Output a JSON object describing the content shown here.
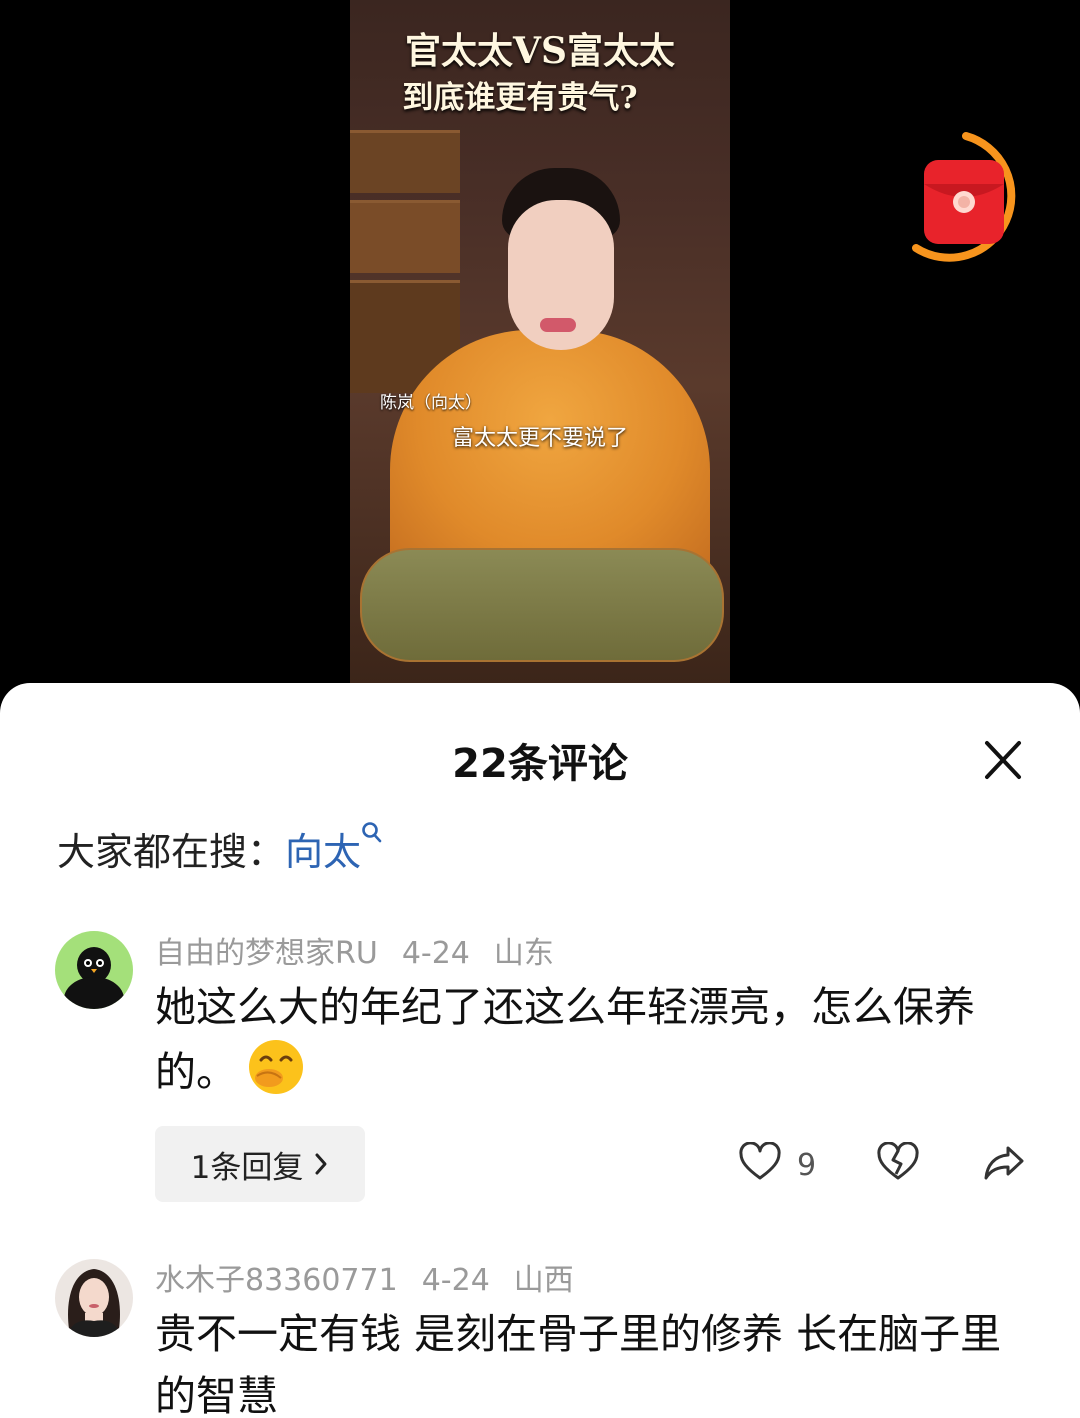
{
  "video": {
    "title_line1": "官太太VS富太太",
    "title_line2": "到底谁更有贵气?",
    "speaker_tag": "陈岚（向太）",
    "subtitle": "富太太更不要说了"
  },
  "redpacket": {
    "icon": "red-envelope-icon",
    "ring_color": "#f7941d"
  },
  "sheet": {
    "title": "22条评论",
    "close_icon": "close-icon",
    "search_prefix": "大家都在搜：",
    "search_term": "向太",
    "search_icon": "search-icon"
  },
  "comments": [
    {
      "username": "自由的梦想家RU",
      "date": "4-24",
      "location": "山东",
      "text": "她这么大的年纪了还这么年轻漂亮，怎么保养的。",
      "emoji": "hand-over-mouth-emoji",
      "reply_label": "1条回复",
      "like_count": "9"
    },
    {
      "username": "水木子83360771",
      "date": "4-24",
      "location": "山西",
      "text": "贵不一定有钱 是刻在骨子里的修养 长在脑子里的智慧"
    }
  ],
  "colors": {
    "link": "#2d64b3",
    "meta": "#9a9a9a",
    "sheet_bg": "#ffffff"
  }
}
